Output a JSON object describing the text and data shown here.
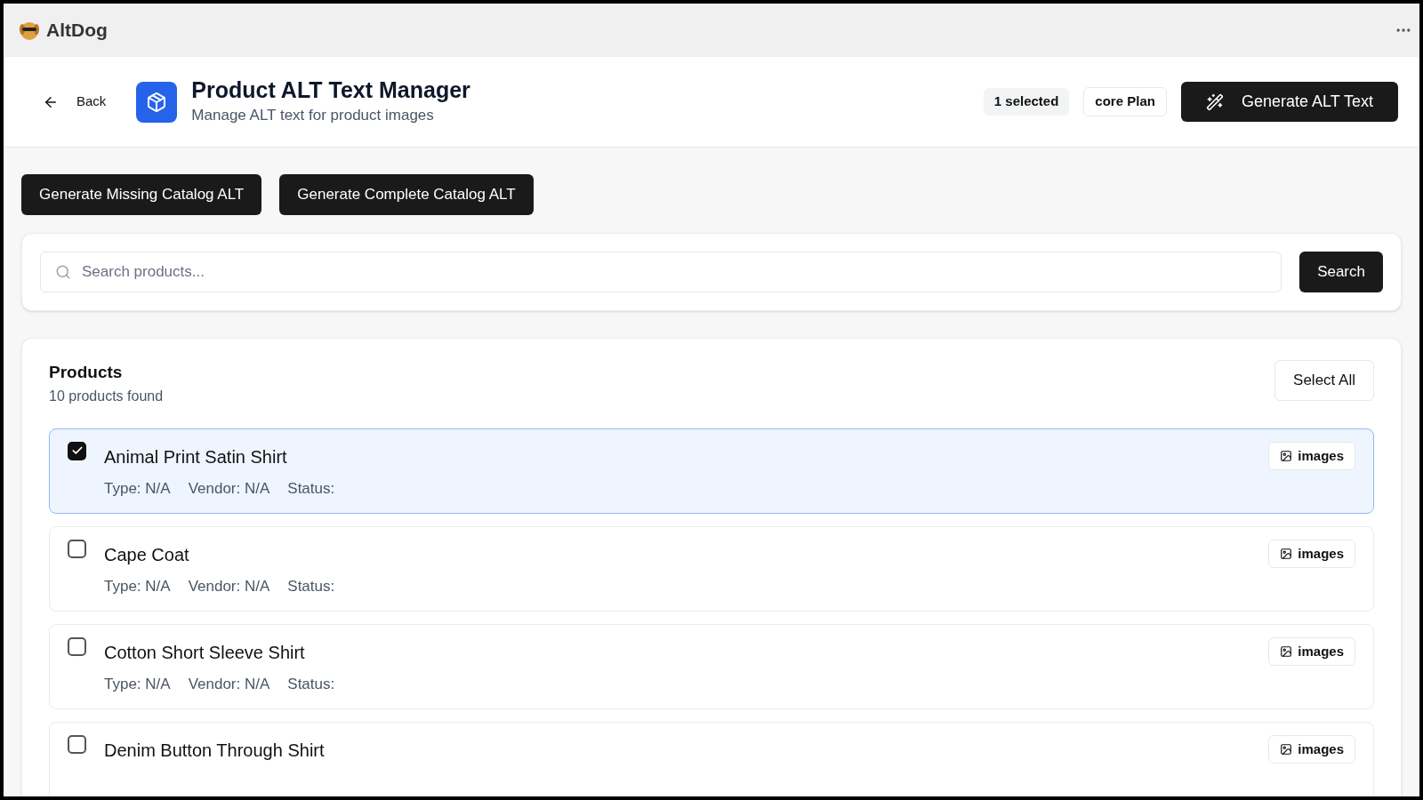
{
  "app": {
    "name": "AltDog"
  },
  "header": {
    "back": "Back",
    "title": "Product ALT Text Manager",
    "subtitle": "Manage ALT text for product images",
    "selected_badge": "1 selected",
    "plan_badge": "core Plan",
    "generate_button": "Generate ALT Text"
  },
  "actions": [
    "Generate Missing Catalog ALT",
    "Generate Complete Catalog ALT"
  ],
  "search": {
    "placeholder": "Search products...",
    "button": "Search"
  },
  "products": {
    "title": "Products",
    "count": "10 products found",
    "select_all": "Select All",
    "items": [
      {
        "name": "Animal Print Satin Shirt",
        "type": "Type: N/A",
        "vendor": "Vendor: N/A",
        "status": "Status:",
        "badge": "images",
        "selected": true
      },
      {
        "name": "Cape Coat",
        "type": "Type: N/A",
        "vendor": "Vendor: N/A",
        "status": "Status:",
        "badge": "images",
        "selected": false
      },
      {
        "name": "Cotton Short Sleeve Shirt",
        "type": "Type: N/A",
        "vendor": "Vendor: N/A",
        "status": "Status:",
        "badge": "images",
        "selected": false
      },
      {
        "name": "Denim Button Through Shirt",
        "badge": "images",
        "selected": false
      }
    ]
  }
}
